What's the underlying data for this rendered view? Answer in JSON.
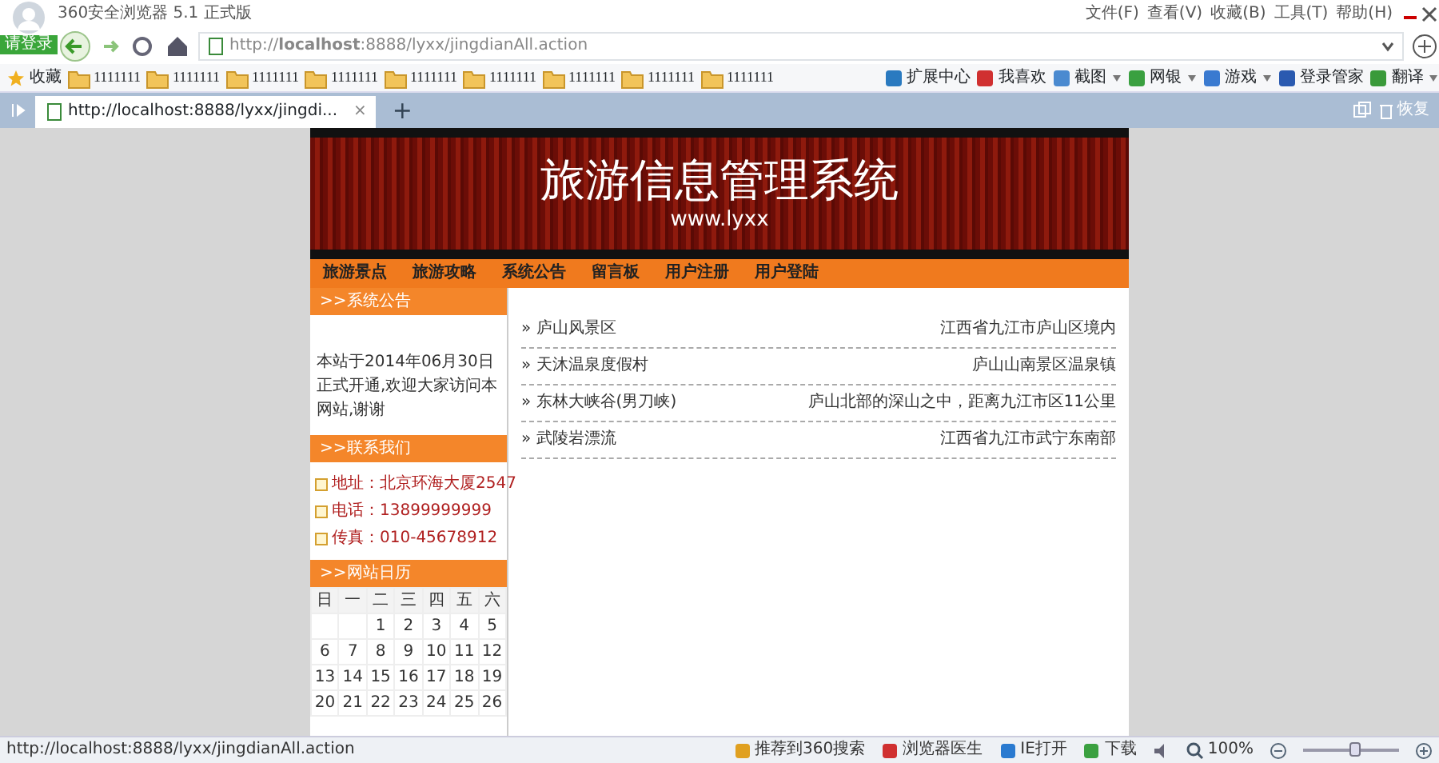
{
  "browser": {
    "title": "360安全浏览器 5.1 正式版",
    "login_label": "请登录",
    "menu": [
      "文件(F)",
      "查看(V)",
      "收藏(B)",
      "工具(T)",
      "帮助(H)"
    ],
    "address": "http://**localhost**:8888/lyxx/jingdianAll.action",
    "favorites_label": "收藏",
    "bookmarks": [
      "1111111",
      "1111111",
      "1111111",
      "1111111",
      "1111111",
      "1111111",
      "1111111",
      "1111111",
      "1111111"
    ],
    "tools": [
      {
        "label": "扩展中心",
        "dropdown": false
      },
      {
        "label": "我喜欢",
        "dropdown": false
      },
      {
        "label": "截图",
        "dropdown": true
      },
      {
        "label": "网银",
        "dropdown": true
      },
      {
        "label": "游戏",
        "dropdown": true
      },
      {
        "label": "登录管家",
        "dropdown": false
      },
      {
        "label": "翻译",
        "dropdown": true
      }
    ],
    "tab": {
      "title": "http://localhost:8888/lyxx/jingdi...",
      "close": "×",
      "new": "+"
    },
    "restore_label": "恢复"
  },
  "page": {
    "banner": {
      "title": "旅游信息管理系统",
      "subtitle": "www.lyxx"
    },
    "nav": [
      "旅游景点",
      "旅游攻略",
      "系统公告",
      "留言板",
      "用户注册",
      "用户登陆"
    ],
    "notice": {
      "title": ">>系统公告",
      "text": "本站于2014年06月30日正式开通,欢迎大家访问本网站,谢谢"
    },
    "contact": {
      "title": ">>联系我们",
      "items": [
        {
          "label": "地址：",
          "value": "北京环海大厦2547"
        },
        {
          "label": "电话：",
          "value": "13899999999"
        },
        {
          "label": "传真：",
          "value": "010-45678912"
        }
      ]
    },
    "calendar": {
      "title": ">>网站日历",
      "weekdays": [
        "日",
        "一",
        "二",
        "三",
        "四",
        "五",
        "六"
      ],
      "weeks": [
        [
          "1",
          "2",
          "3",
          "4",
          "5"
        ],
        [
          "6",
          "7",
          "8",
          "9",
          "10",
          "11",
          "12"
        ],
        [
          "13",
          "14",
          "15",
          "16",
          "17",
          "18",
          "19"
        ],
        [
          "20",
          "21",
          "22",
          "23",
          "24",
          "25",
          "26"
        ]
      ]
    },
    "scenic_spots": [
      {
        "name": "» 庐山风景区",
        "location": "江西省九江市庐山区境内"
      },
      {
        "name": "» 天沐温泉度假村",
        "location": "庐山山南景区温泉镇"
      },
      {
        "name": "» 东林大峡谷(男刀峡)",
        "location": "庐山北部的深山之中，距离九江市区11公里"
      },
      {
        "name": "» 武陵岩漂流",
        "location": "江西省九江市武宁东南部"
      }
    ]
  },
  "status_bar": {
    "url": "http://localhost:8888/lyxx/jingdianAll.action",
    "items": [
      "推荐到360搜索",
      "浏览器医生",
      "IE打开",
      "下载"
    ],
    "zoom": "100%",
    "level": 0.55
  }
}
